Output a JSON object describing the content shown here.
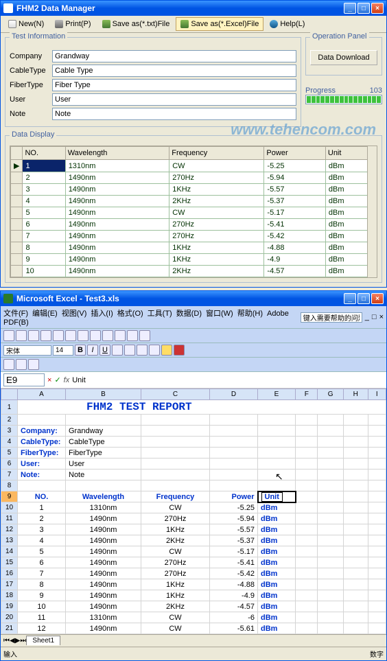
{
  "app1": {
    "title": "FHM2 Data Manager",
    "toolbar": {
      "new": "New(N)",
      "print": "Print(P)",
      "save_txt": "Save as(*.txt)File",
      "save_excel": "Save as(*.Excel)File",
      "help": "Help(L)"
    },
    "test_info": {
      "legend": "Test Information",
      "fields": {
        "company_lbl": "Company",
        "company_val": "Grandway",
        "cabletype_lbl": "CableType",
        "cabletype_val": "Cable Type",
        "fibertype_lbl": "FiberType",
        "fibertype_val": "Fiber Type",
        "user_lbl": "User",
        "user_val": "User",
        "note_lbl": "Note",
        "note_val": "Note"
      }
    },
    "op_panel": {
      "legend": "Operation Panel",
      "download_btn": "Data Download",
      "progress_lbl": "Progress",
      "progress_val": 103
    },
    "data_display": {
      "legend": "Data Display",
      "columns": [
        "NO.",
        "Wavelength",
        "Frequency",
        "Power",
        "Unit"
      ],
      "rows": [
        {
          "no": "1",
          "wl": "1310nm",
          "fq": "CW",
          "pw": "-5.25",
          "un": "dBm"
        },
        {
          "no": "2",
          "wl": "1490nm",
          "fq": "270Hz",
          "pw": "-5.94",
          "un": "dBm"
        },
        {
          "no": "3",
          "wl": "1490nm",
          "fq": "1KHz",
          "pw": "-5.57",
          "un": "dBm"
        },
        {
          "no": "4",
          "wl": "1490nm",
          "fq": "2KHz",
          "pw": "-5.37",
          "un": "dBm"
        },
        {
          "no": "5",
          "wl": "1490nm",
          "fq": "CW",
          "pw": "-5.17",
          "un": "dBm"
        },
        {
          "no": "6",
          "wl": "1490nm",
          "fq": "270Hz",
          "pw": "-5.41",
          "un": "dBm"
        },
        {
          "no": "7",
          "wl": "1490nm",
          "fq": "270Hz",
          "pw": "-5.42",
          "un": "dBm"
        },
        {
          "no": "8",
          "wl": "1490nm",
          "fq": "1KHz",
          "pw": "-4.88",
          "un": "dBm"
        },
        {
          "no": "9",
          "wl": "1490nm",
          "fq": "1KHz",
          "pw": "-4.9",
          "un": "dBm"
        },
        {
          "no": "10",
          "wl": "1490nm",
          "fq": "2KHz",
          "pw": "-4.57",
          "un": "dBm"
        }
      ]
    }
  },
  "watermark": "www.tehencom.com",
  "app2": {
    "title": "Microsoft Excel - Test3.xls",
    "menus": [
      "文件(F)",
      "编辑(E)",
      "视图(V)",
      "插入(I)",
      "格式(O)",
      "工具(T)",
      "数据(D)",
      "窗口(W)",
      "帮助(H)",
      "Adobe PDF(B)"
    ],
    "search_placeholder": "键入需要帮助的问题",
    "font_name": "宋体",
    "font_size": 14,
    "cell_ref": "E9",
    "cell_val": "Unit",
    "columns": [
      "A",
      "B",
      "C",
      "D",
      "E",
      "F",
      "G",
      "H",
      "I"
    ],
    "report_title": "FHM2 TEST REPORT",
    "meta": [
      {
        "row": 3,
        "k": "Company:",
        "v": "Grandway"
      },
      {
        "row": 4,
        "k": "CableType:",
        "v": "CableType"
      },
      {
        "row": 5,
        "k": "FiberType:",
        "v": "FiberType"
      },
      {
        "row": 6,
        "k": "User:",
        "v": "User"
      },
      {
        "row": 7,
        "k": "Note:",
        "v": "Note"
      }
    ],
    "headers": [
      "NO.",
      "Wavelength",
      "Frequency",
      "Power",
      "Unit"
    ],
    "data": [
      {
        "r": 10,
        "no": "1",
        "wl": "1310nm",
        "fq": "CW",
        "pw": "-5.25",
        "un": "dBm"
      },
      {
        "r": 11,
        "no": "2",
        "wl": "1490nm",
        "fq": "270Hz",
        "pw": "-5.94",
        "un": "dBm"
      },
      {
        "r": 12,
        "no": "3",
        "wl": "1490nm",
        "fq": "1KHz",
        "pw": "-5.57",
        "un": "dBm"
      },
      {
        "r": 13,
        "no": "4",
        "wl": "1490nm",
        "fq": "2KHz",
        "pw": "-5.37",
        "un": "dBm"
      },
      {
        "r": 14,
        "no": "5",
        "wl": "1490nm",
        "fq": "CW",
        "pw": "-5.17",
        "un": "dBm"
      },
      {
        "r": 15,
        "no": "6",
        "wl": "1490nm",
        "fq": "270Hz",
        "pw": "-5.41",
        "un": "dBm"
      },
      {
        "r": 16,
        "no": "7",
        "wl": "1490nm",
        "fq": "270Hz",
        "pw": "-5.42",
        "un": "dBm"
      },
      {
        "r": 17,
        "no": "8",
        "wl": "1490nm",
        "fq": "1KHz",
        "pw": "-4.88",
        "un": "dBm"
      },
      {
        "r": 18,
        "no": "9",
        "wl": "1490nm",
        "fq": "1KHz",
        "pw": "-4.9",
        "un": "dBm"
      },
      {
        "r": 19,
        "no": "10",
        "wl": "1490nm",
        "fq": "2KHz",
        "pw": "-4.57",
        "un": "dBm"
      },
      {
        "r": 20,
        "no": "11",
        "wl": "1310nm",
        "fq": "CW",
        "pw": "-6",
        "un": "dBm"
      },
      {
        "r": 21,
        "no": "12",
        "wl": "1490nm",
        "fq": "CW",
        "pw": "-5.61",
        "un": "dBm"
      }
    ],
    "sheet_tab": "Sheet1",
    "status_left": "输入",
    "status_right": "数字"
  }
}
